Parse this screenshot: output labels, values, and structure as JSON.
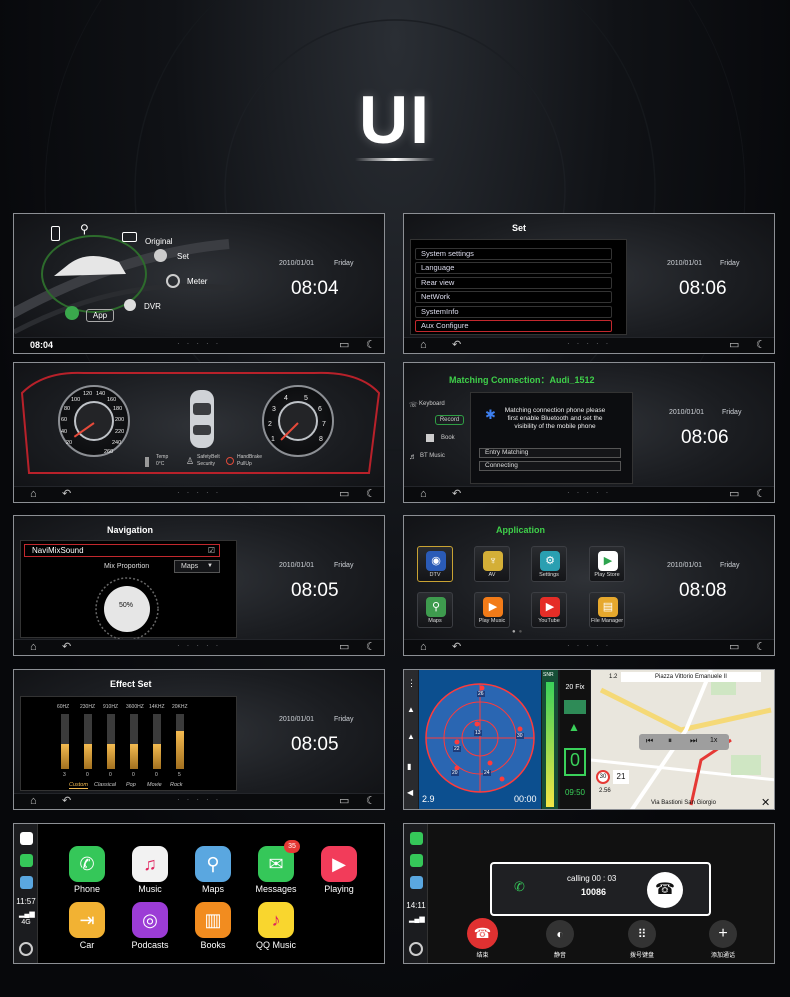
{
  "header": {
    "title": "UI"
  },
  "home": {
    "labels": {
      "original": "Original",
      "set": "Set",
      "meter": "Meter",
      "dvr": "DVR",
      "app": "App"
    },
    "date": "2010/01/01",
    "day": "Friday",
    "time": "08:04",
    "bar_time": "08:04"
  },
  "settings": {
    "title": "Set",
    "items": [
      "System settings",
      "Language",
      "Rear view",
      "NetWork",
      "SystemInfo",
      "Aux Configure"
    ],
    "date": "2010/01/01",
    "day": "Friday",
    "time": "08:06"
  },
  "cluster": {
    "speed_ticks": [
      "20",
      "40",
      "60",
      "80",
      "100",
      "120",
      "140",
      "160",
      "180",
      "200",
      "220",
      "240",
      "260"
    ],
    "rpm_ticks": [
      "1",
      "2",
      "3",
      "4",
      "5",
      "6",
      "7",
      "8"
    ],
    "temp_label": "Temp",
    "temp_value": "0°C",
    "seatbelt_label": "SafetyBelt Security",
    "handbrake_label": "HandBrake PullUp"
  },
  "bluetooth": {
    "title": "Matching Connection：Audi_1512",
    "side": [
      "Keyboard",
      "Record",
      "Book",
      "BT Music"
    ],
    "message": "Matching connection phone please first enable Bluetooth and set the visibility of the mobile phone",
    "buttons": [
      "Entry Matching",
      "Connecting"
    ],
    "date": "2010/01/01",
    "day": "Friday",
    "time": "08:06"
  },
  "navigation": {
    "title": "Navigation",
    "app": "NaviMixSound",
    "mix_label": "Mix Proportion",
    "mix_value": "50%",
    "maps_label": "Maps",
    "date": "2010/01/01",
    "day": "Friday",
    "time": "08:05"
  },
  "apps": {
    "title": "Application",
    "items": [
      {
        "label": "DTV",
        "icon": "tv-icon",
        "color": "#2a5bb7",
        "sym": "◉"
      },
      {
        "label": "AV",
        "icon": "av-icon",
        "color": "#d4af37",
        "sym": "♆"
      },
      {
        "label": "Settings",
        "icon": "gear-icon",
        "color": "#2a9fb1",
        "sym": "⚙"
      },
      {
        "label": "Play Store",
        "icon": "play-store-icon",
        "color": "#ffffff",
        "sym": "▶"
      },
      {
        "label": "Maps",
        "icon": "maps-icon",
        "color": "#3e9b4e",
        "sym": "⚲"
      },
      {
        "label": "Play Music",
        "icon": "play-music-icon",
        "color": "#f27b18",
        "sym": "▶"
      },
      {
        "label": "YouTube",
        "icon": "youtube-icon",
        "color": "#e52d27",
        "sym": "▶"
      },
      {
        "label": "File Manager",
        "icon": "file-manager-icon",
        "color": "#e6a82d",
        "sym": "▤"
      }
    ],
    "date": "2010/01/01",
    "day": "Friday",
    "time": "08:08"
  },
  "effects": {
    "title": "Effect Set",
    "bands": [
      "60HZ",
      "230HZ",
      "910HZ",
      "3600HZ",
      "14KHZ",
      "20KHZ"
    ],
    "levels": [
      0.45,
      0.45,
      0.45,
      0.45,
      0.45,
      0.7
    ],
    "values": [
      "3",
      "0",
      "0",
      "0",
      "0",
      "5"
    ],
    "presets": [
      "Custom",
      "Classical",
      "Pop",
      "Movie",
      "Rock"
    ],
    "date": "2010/01/01",
    "day": "Friday",
    "time": "08:05"
  },
  "gps": {
    "sat_ids": [
      "13",
      "24",
      "30",
      "20",
      "22",
      "26"
    ],
    "snr": "SNR",
    "fix": "20 Fix",
    "speed": "0",
    "time": "09:50",
    "elapsed": "00:00",
    "bottom_left": "2.9",
    "street_top": "Piazza Vittorio Emanuele II",
    "street_bottom": "Via Bastioni San Giorgio",
    "distance": "2.56",
    "speed_limit": "30",
    "speed_now": "21",
    "zoom": "1x",
    "scale": "1.2"
  },
  "carplay": {
    "time": "11:57",
    "signal": "4G",
    "apps": [
      {
        "label": "Phone",
        "icon": "phone-icon",
        "color": "#35c759",
        "sym": "✆"
      },
      {
        "label": "Music",
        "icon": "music-icon",
        "color": "#f2f2f2",
        "sym": "♫"
      },
      {
        "label": "Maps",
        "icon": "maps-icon",
        "color": "#5aa7e0",
        "sym": "⚲"
      },
      {
        "label": "Messages",
        "icon": "messages-icon",
        "color": "#35c759",
        "sym": "✉",
        "badge": "35"
      },
      {
        "label": "Playing",
        "icon": "now-playing-icon",
        "color": "#f23c5a",
        "sym": "▶"
      },
      {
        "label": "Car",
        "icon": "car-icon",
        "color": "#f2b233",
        "sym": "⇥"
      },
      {
        "label": "Podcasts",
        "icon": "podcasts-icon",
        "color": "#9c3cd6",
        "sym": "◎"
      },
      {
        "label": "Books",
        "icon": "books-icon",
        "color": "#f28c1f",
        "sym": "▥"
      },
      {
        "label": "QQ Music",
        "icon": "qq-music-icon",
        "color": "#f9d62e",
        "sym": "♪"
      }
    ]
  },
  "call": {
    "time": "14:11",
    "status": "calling  00 : 03",
    "number": "10086",
    "end": "结束",
    "mute": "静音",
    "keypad": "拨号键盘",
    "add": "添加通话"
  }
}
